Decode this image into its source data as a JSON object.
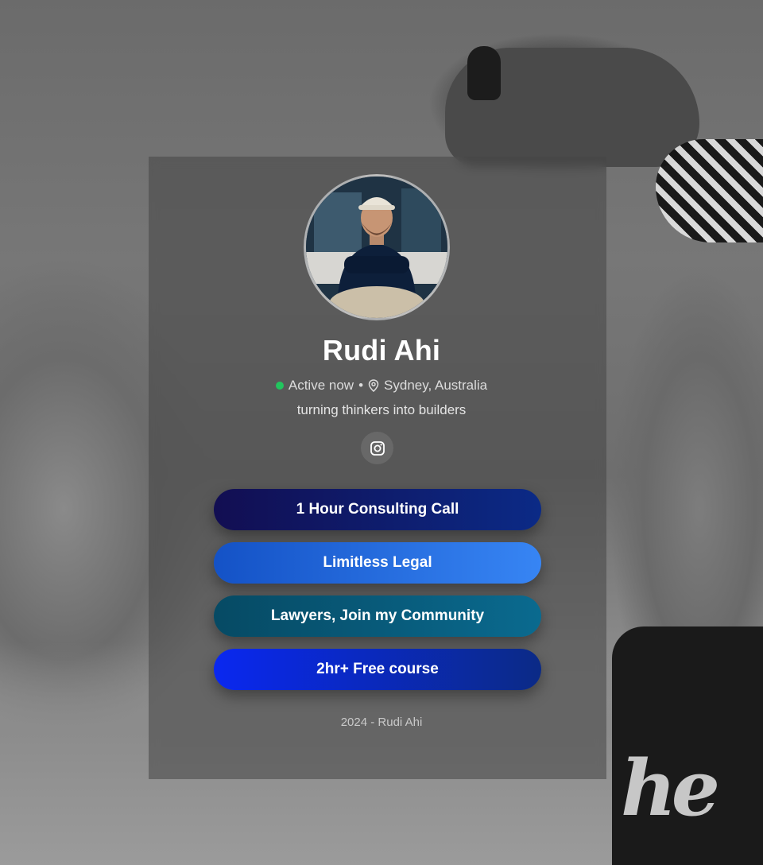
{
  "profile": {
    "name": "Rudi Ahi",
    "status": "Active now",
    "separator": "•",
    "location": "Sydney, Australia",
    "bio": "turning thinkers into builders",
    "status_color": "#22c55e"
  },
  "social": {
    "icon": "instagram-icon"
  },
  "links": [
    {
      "label": "1 Hour Consulting Call"
    },
    {
      "label": "Limitless Legal"
    },
    {
      "label": "Lawyers, Join my Community"
    },
    {
      "label": "2hr+ Free course"
    }
  ],
  "footer": {
    "text": "2024 - Rudi Ahi"
  }
}
